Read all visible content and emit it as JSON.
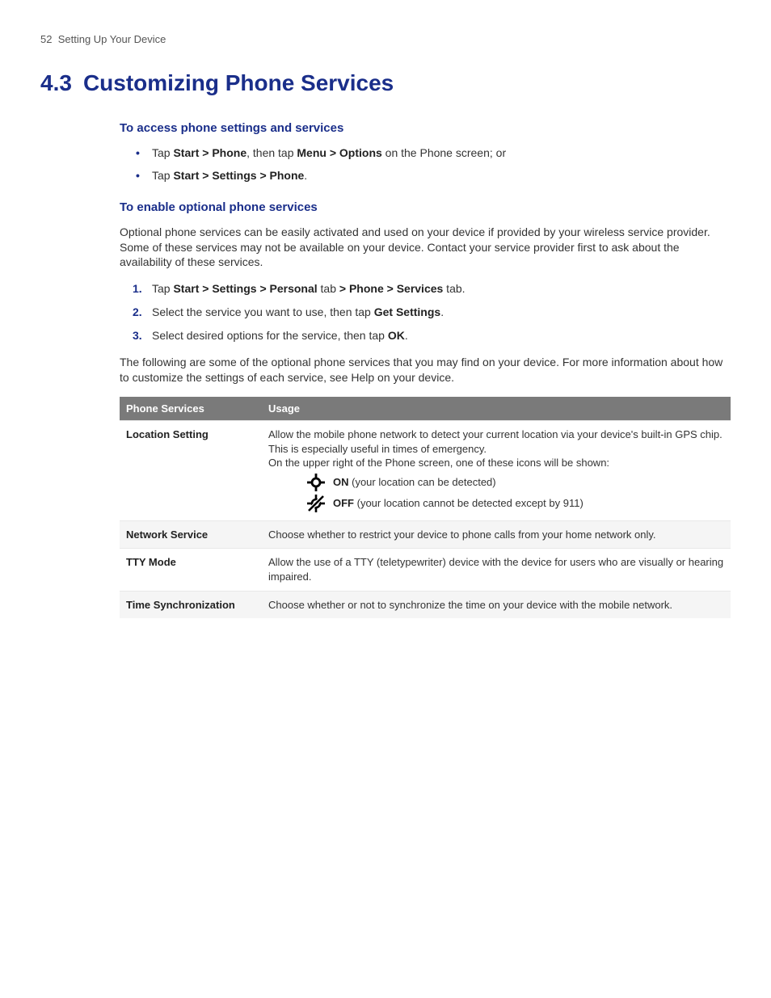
{
  "header": {
    "page_num": "52",
    "running_title": "Setting Up Your Device"
  },
  "title": {
    "num": "4.3",
    "text": "Customizing Phone Services"
  },
  "sec1": {
    "heading": "To access phone settings and services",
    "b1": {
      "pre": "Tap ",
      "bold1": "Start > Phone",
      "mid": ", then tap ",
      "bold2": "Menu > Options",
      "post": " on the Phone screen; or"
    },
    "b2": {
      "pre": "Tap ",
      "bold1": "Start > Settings > Phone",
      "post": "."
    }
  },
  "sec2": {
    "heading": "To enable optional phone services",
    "intro": "Optional phone services can be easily activated and used on your device if provided by your wireless service provider. Some of these services may not be available on your device. Contact your service provider first to ask about the availability of these services.",
    "s1": {
      "pre": "Tap ",
      "b1": "Start > Settings > Personal",
      "m1": " tab ",
      "b2": "> Phone > Services",
      "post": " tab."
    },
    "s2": {
      "pre": "Select the service you want to use, then tap ",
      "b1": "Get Settings",
      "post": "."
    },
    "s3": {
      "pre": "Select desired options for the service, then tap ",
      "b1": "OK",
      "post": "."
    },
    "outro": "The following are some of the optional phone services that you may find on your device. For more information about how to customize the settings of each service, see Help on your device."
  },
  "table": {
    "col1": "Phone Services",
    "col2": "Usage",
    "r1": {
      "label": "Location Setting",
      "line1": "Allow the mobile phone network to detect your current location via your device's built-in GPS chip. This is especially useful in times of emergency.",
      "line2": "On the upper right of the Phone screen, one of these icons will be shown:",
      "on_b": "ON",
      "on_t": " (your location can be detected)",
      "off_b": "OFF",
      "off_t": " (your location cannot be detected except by 911)"
    },
    "r2": {
      "label": "Network Service",
      "text": "Choose whether to restrict your device to phone calls from your home network only."
    },
    "r3": {
      "label": "TTY Mode",
      "text": "Allow the use of a TTY (teletypewriter) device with the device for users who are visually or hearing impaired."
    },
    "r4": {
      "label": "Time Synchronization",
      "text": "Choose whether or not to synchronize the time on your device with the mobile network."
    }
  }
}
